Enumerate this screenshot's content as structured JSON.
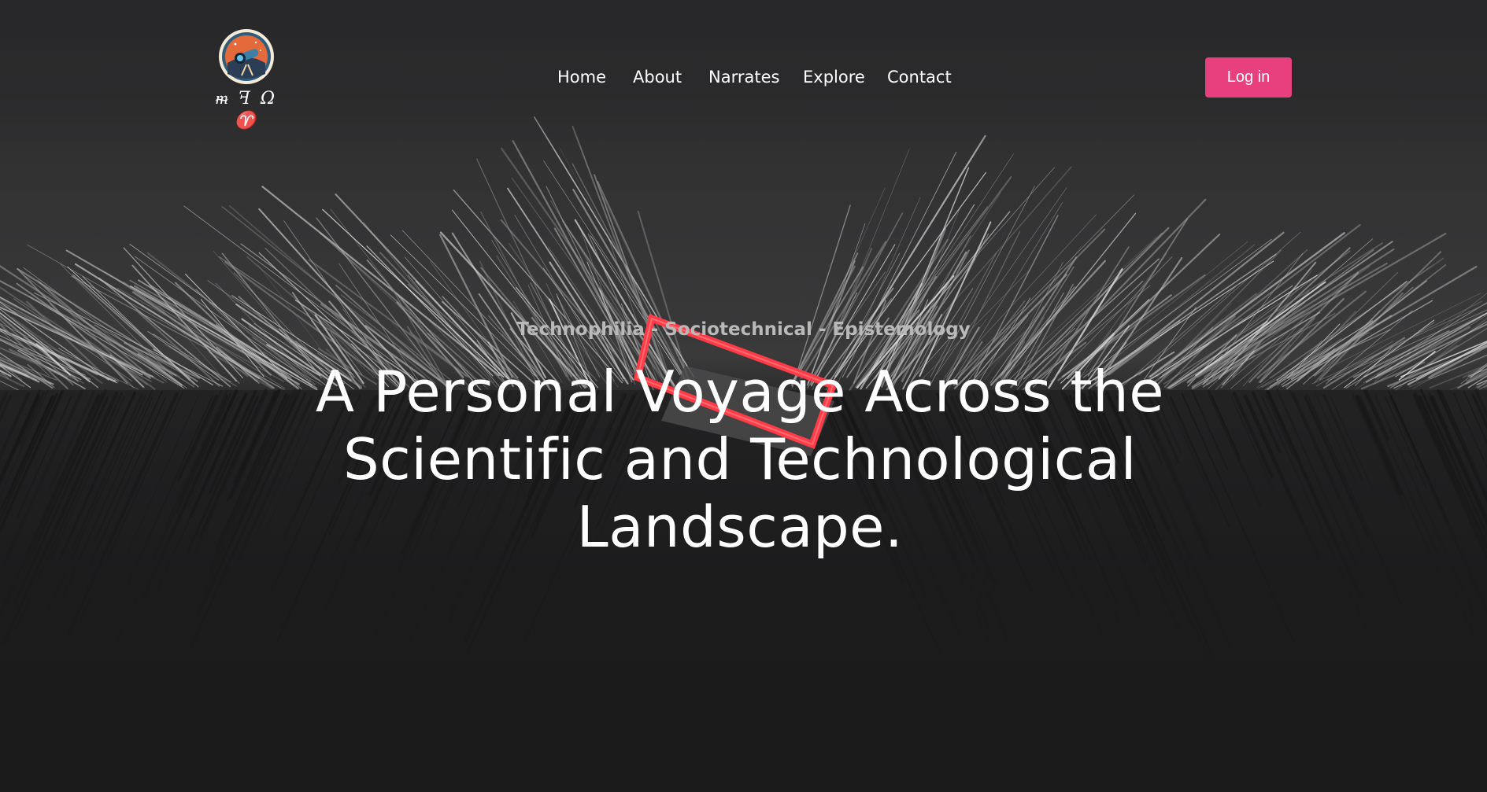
{
  "site": {
    "logo_wordmark": "ᵯ ꟻ Ω ♈",
    "colors": {
      "background": "#1b1b1c",
      "accent": "#e8407f",
      "text": "#ffffff",
      "tagline": "#b9b9b9",
      "frame": "#ff3b47"
    }
  },
  "nav": {
    "items": [
      {
        "label": "Home"
      },
      {
        "label": "About"
      },
      {
        "label": "Narrates"
      },
      {
        "label": "Explore"
      },
      {
        "label": "Contact"
      }
    ],
    "login_label": "Log in"
  },
  "hero": {
    "tagline": "Technophilia - Sociotechnical - Epistemology",
    "title_line1": "A Personal Voyage Across the",
    "title_line2": "Scientific and Technological",
    "title_line3": "Landscape."
  },
  "icons": {
    "logo": "telescope-emblem-icon",
    "decoration": "red-frame-icon"
  }
}
